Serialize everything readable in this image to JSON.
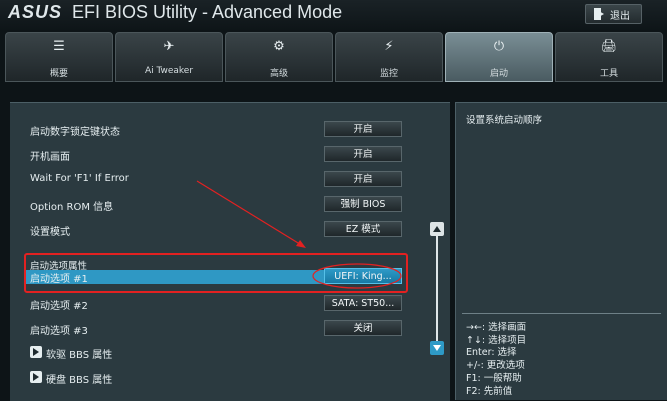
{
  "header": {
    "brand": "ASUS",
    "title": "EFI BIOS Utility - Advanced Mode",
    "exit_label": "退出"
  },
  "tabs": [
    {
      "label": "概要",
      "icon": "☰"
    },
    {
      "label": "Ai Tweaker",
      "icon": "✈"
    },
    {
      "label": "高级",
      "icon": "⚙"
    },
    {
      "label": "监控",
      "icon": "⚡"
    },
    {
      "label": "启动",
      "icon": "⏻",
      "active": true
    },
    {
      "label": "工具",
      "icon": "🖨"
    }
  ],
  "settings": [
    {
      "label": "启动数字锁定键状态",
      "value": "开启"
    },
    {
      "label": "开机画面",
      "value": "开启"
    },
    {
      "label": "Wait For 'F1' If Error",
      "value": "开启"
    },
    {
      "label": "Option ROM 信息",
      "value": "强制 BIOS"
    },
    {
      "label": "设置模式",
      "value": "EZ 模式"
    }
  ],
  "boot_section_title": "启动选项属性",
  "boot_options": [
    {
      "label": "启动选项 #1",
      "value": "UEFI: King..."
    },
    {
      "label": "启动选项 #2",
      "value": "SATA: ST50..."
    },
    {
      "label": "启动选项 #3",
      "value": "关闭"
    }
  ],
  "submenus": [
    {
      "label": "软驱 BBS 属性"
    },
    {
      "label": "硬盘 BBS 属性"
    }
  ],
  "side": {
    "help_text": "设置系统启动顺序",
    "hints": [
      "→←: 选择画面",
      "↑↓: 选择项目",
      "Enter: 选择",
      "+/-: 更改选项",
      "F1: 一般帮助",
      "F2: 先前值"
    ]
  },
  "colors": {
    "accent": "#2e9ac7",
    "annotation": "#e32121"
  }
}
